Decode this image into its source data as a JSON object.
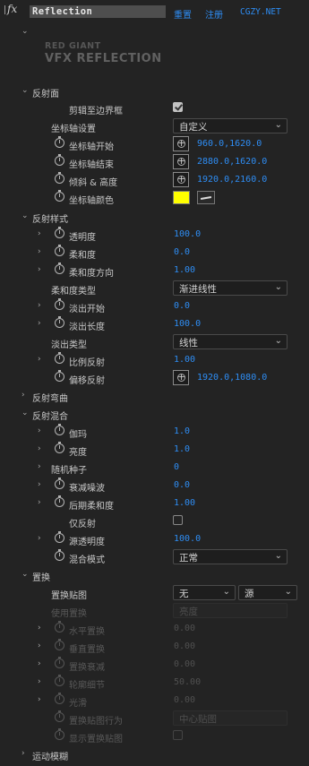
{
  "header": {
    "fx": "fx",
    "effect_name": "Reflection",
    "reset": "重置",
    "register": "注册",
    "site": "CGZY.NET"
  },
  "logo": {
    "line1": "RED GIANT",
    "line2": "VFX REFLECTION"
  },
  "sections": {
    "reflection_plane": "反射面",
    "reflection_style": "反射样式",
    "reflection_bend": "反射弯曲",
    "reflection_blend": "反射混合",
    "displacement": "置换",
    "motion_blur": "运动模糊"
  },
  "plane": {
    "clip_label": "剪辑至边界框",
    "axis_settings_label": "坐标轴设置",
    "axis_settings_value": "自定义",
    "axis_start_label": "坐标轴开始",
    "axis_start_value": "960.0,1620.0",
    "axis_end_label": "坐标轴结束",
    "axis_end_value": "2880.0,1620.0",
    "tilt_label": "倾斜 & 高度",
    "tilt_value": "1920.0,2160.0",
    "axis_color_label": "坐标轴颜色",
    "axis_color": "#ffff00"
  },
  "style": {
    "opacity_label": "透明度",
    "opacity_value": "100.0",
    "softness_label": "柔和度",
    "softness_value": "0.0",
    "softdir_label": "柔和度方向",
    "softdir_value": "1.00",
    "softtype_label": "柔和度类型",
    "softtype_value": "渐进线性",
    "fadestart_label": "淡出开始",
    "fadestart_value": "0.0",
    "fadelen_label": "淡出长度",
    "fadelen_value": "100.0",
    "fadetype_label": "淡出类型",
    "fadetype_value": "线性",
    "scale_label": "比例反射",
    "scale_value": "1.00",
    "offset_label": "偏移反射",
    "offset_value": "1920.0,1080.0"
  },
  "blend": {
    "gamma_label": "伽玛",
    "gamma_value": "1.0",
    "brightness_label": "亮度",
    "brightness_value": "1.0",
    "seed_label": "随机种子",
    "seed_value": "0",
    "noise_label": "衰减噪波",
    "noise_value": "0.0",
    "post_soft_label": "后期柔和度",
    "post_soft_value": "1.00",
    "only_refl_label": "仅反射",
    "src_opacity_label": "源透明度",
    "src_opacity_value": "100.0",
    "mode_label": "混合模式",
    "mode_value": "正常"
  },
  "disp": {
    "map_label": "置换贴图",
    "map_value": "无",
    "map_src": "源",
    "use_label": "使用置换",
    "use_value": "亮度",
    "h_label": "水平置换",
    "h_value": "0.00",
    "v_label": "垂直置换",
    "v_value": "0.00",
    "falloff_label": "置换衰减",
    "falloff_value": "0.00",
    "detail_label": "轮廓细节",
    "detail_value": "50.00",
    "smooth_label": "光滑",
    "smooth_value": "0.00",
    "behavior_label": "置换贴图行为",
    "behavior_value": "中心贴图",
    "show_label": "显示置换贴图"
  }
}
